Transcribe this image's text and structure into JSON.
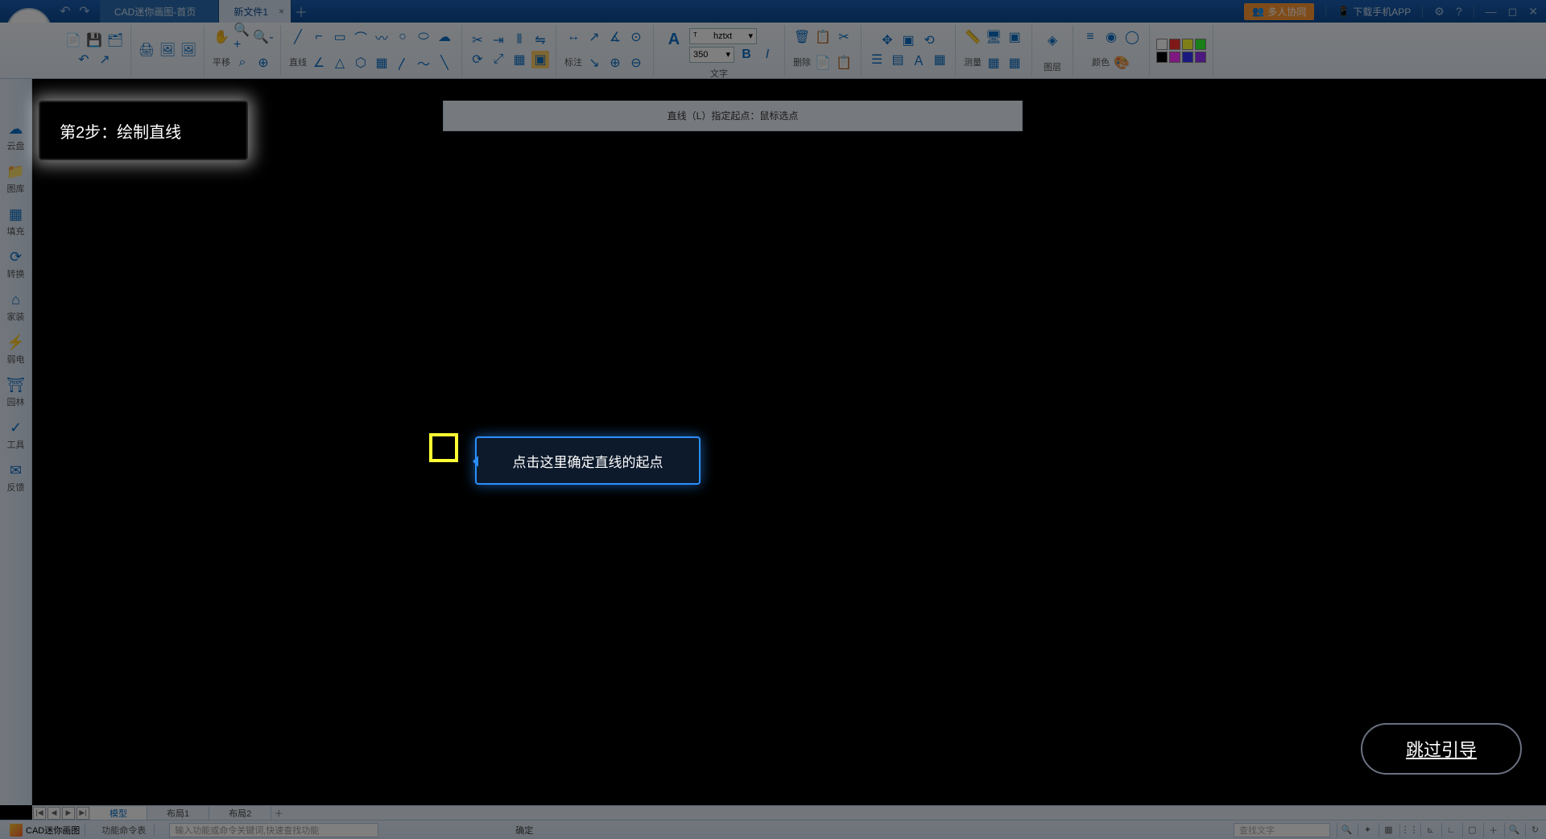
{
  "titlebar": {
    "tab_home": "CAD迷你画图-首页",
    "tab_active": "新文件1",
    "collab": "多人协同",
    "download_app": "下载手机APP"
  },
  "ribbon": {
    "pan": "平移",
    "line": "直线",
    "annotate": "标注",
    "text": "文字",
    "delete": "删除",
    "measure": "测量",
    "layer": "图层",
    "color": "颜色",
    "font_name": "hztxt",
    "font_size": "350",
    "bold": "B",
    "italic": "I"
  },
  "cmd_hint": "直线（L）指定起点：鼠标选点",
  "leftbar": [
    {
      "label": "云盘"
    },
    {
      "label": "图库"
    },
    {
      "label": "填充"
    },
    {
      "label": "转换"
    },
    {
      "label": "家装"
    },
    {
      "label": "弱电"
    },
    {
      "label": "园林"
    },
    {
      "label": "工具"
    },
    {
      "label": "反馈"
    }
  ],
  "tutorial": {
    "step_title": "第2步：绘制直线",
    "tooltip": "点击这里确定直线的起点",
    "skip": "跳过引导"
  },
  "layout_tabs": {
    "model": "模型",
    "layout1": "布局1",
    "layout2": "布局2"
  },
  "statusbar": {
    "app_name": "CAD迷你画图",
    "cmd_list": "功能命令表",
    "cmd_placeholder": "输入功能或命令关键词,快速查找功能",
    "ok": "确定",
    "find_placeholder": "查找文字"
  },
  "colors": {
    "swatches_top": [
      "#ffffff",
      "#ff3333",
      "#ffff33",
      "#33ff33"
    ],
    "swatches_bot": [
      "#000000",
      "#ff33ff",
      "#3333ff",
      "#9933ff"
    ]
  }
}
